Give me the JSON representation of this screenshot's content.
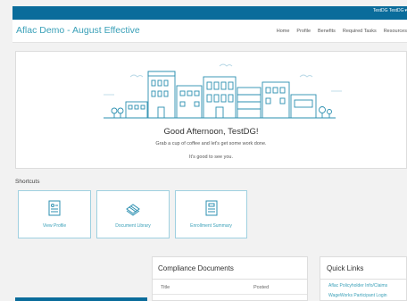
{
  "topbar": {
    "user_label": "TestDG TestDG",
    "caret": "▾"
  },
  "header": {
    "brand": "Aflac Demo - August Effective",
    "nav": [
      "Home",
      "Profile",
      "Benefits",
      "Required Tasks",
      "Resources"
    ]
  },
  "hero": {
    "greeting": "Good Afternoon, TestDG!",
    "line1": "Grab a cup of coffee and let's get some work done.",
    "line2": "It's good to see you."
  },
  "shortcuts": {
    "title": "Shortcuts",
    "items": [
      {
        "label": "View Profile",
        "icon": "profile-document-icon"
      },
      {
        "label": "Document Library",
        "icon": "stacked-documents-icon"
      },
      {
        "label": "Enrollment Summary",
        "icon": "summary-document-icon"
      }
    ]
  },
  "compliance": {
    "title": "Compliance Documents",
    "columns": [
      "Title",
      "Posted"
    ]
  },
  "quick_links": {
    "title": "Quick Links",
    "links": [
      "Aflac Policyholder Info/Claims",
      "WageWorks Participant Login"
    ]
  },
  "colors": {
    "brand_blue": "#0a6c9b",
    "accent": "#3aa0b8"
  }
}
